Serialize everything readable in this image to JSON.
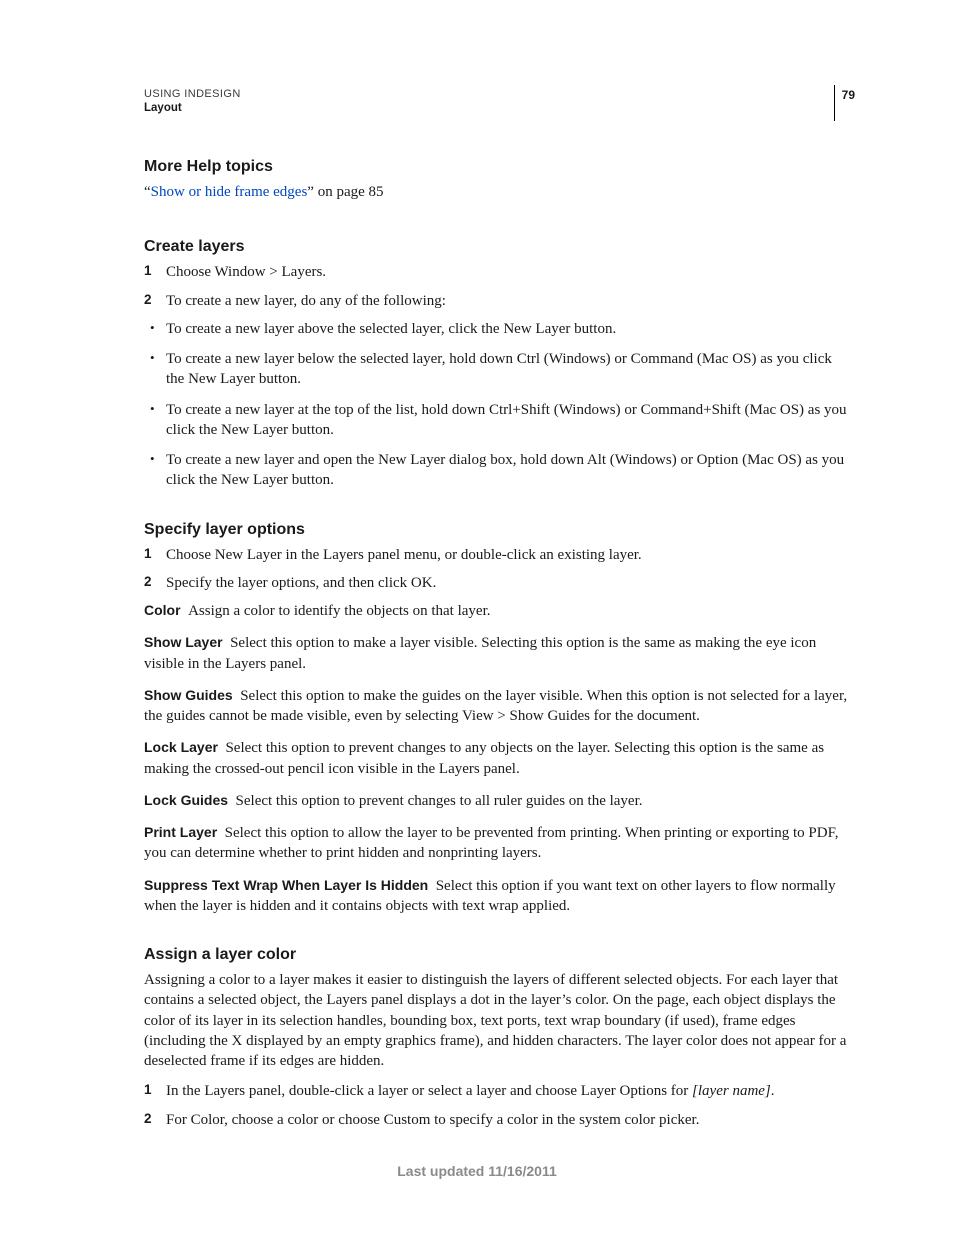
{
  "header": {
    "title": "USING INDESIGN",
    "section": "Layout",
    "page_number": "79"
  },
  "more_help": {
    "heading": "More Help topics",
    "quote_open": "“",
    "link_text": "Show or hide frame edges",
    "quote_close": "”",
    "after_link": " on page 85"
  },
  "create_layers": {
    "heading": "Create layers",
    "steps": [
      "Choose Window > Layers.",
      "To create a new layer, do any of the following:"
    ],
    "bullets": [
      "To create a new layer above the selected layer, click the New Layer button.",
      "To create a new layer below the selected layer, hold down Ctrl (Windows) or Command (Mac OS) as you click the New Layer button.",
      "To create a new layer at the top of the list, hold down Ctrl+Shift (Windows) or Command+Shift (Mac OS) as you click the New Layer button.",
      "To create a new layer and open the New Layer dialog box, hold down Alt (Windows) or Option (Mac OS) as you click the New Layer button."
    ]
  },
  "specify_options": {
    "heading": "Specify layer options",
    "steps": [
      "Choose New Layer in the Layers panel menu, or double-click an existing layer.",
      "Specify the layer options, and then click OK."
    ],
    "defs": [
      {
        "term": "Color",
        "text": "Assign a color to identify the objects on that layer."
      },
      {
        "term": "Show Layer",
        "text": "Select this option to make a layer visible. Selecting this option is the same as making the eye icon visible in the Layers panel."
      },
      {
        "term": "Show Guides",
        "text": "Select this option to make the guides on the layer visible. When this option is not selected for a layer, the guides cannot be made visible, even by selecting View > Show Guides for the document."
      },
      {
        "term": "Lock Layer",
        "text": "Select this option to prevent changes to any objects on the layer. Selecting this option is the same as making the crossed-out pencil icon visible in the Layers panel."
      },
      {
        "term": "Lock Guides",
        "text": "Select this option to prevent changes to all ruler guides on the layer."
      },
      {
        "term": "Print Layer",
        "text": "Select this option to allow the layer to be prevented from printing. When printing or exporting to PDF, you can determine whether to print hidden and nonprinting layers."
      },
      {
        "term": "Suppress Text Wrap When Layer Is Hidden",
        "text": "Select this option if you want text on other layers to flow normally when the layer is hidden and it contains objects with text wrap applied."
      }
    ]
  },
  "assign_color": {
    "heading": "Assign a layer color",
    "intro": "Assigning a color to a layer makes it easier to distinguish the layers of different selected objects. For each layer that contains a selected object, the Layers panel displays a dot in the layer’s color. On the page, each object displays the color of its layer in its selection handles, bounding box, text ports, text wrap boundary (if used), frame edges (including the X displayed by an empty graphics frame), and hidden characters. The layer color does not appear for a deselected frame if its edges are hidden.",
    "step1_pre": "In the Layers panel, double-click a layer or select a layer and choose Layer Options for ",
    "step1_ital": "[layer name]",
    "step1_post": ".",
    "step2": "For Color, choose a color or choose Custom to specify a color in the system color picker."
  },
  "footer": {
    "text": "Last updated 11/16/2011"
  }
}
